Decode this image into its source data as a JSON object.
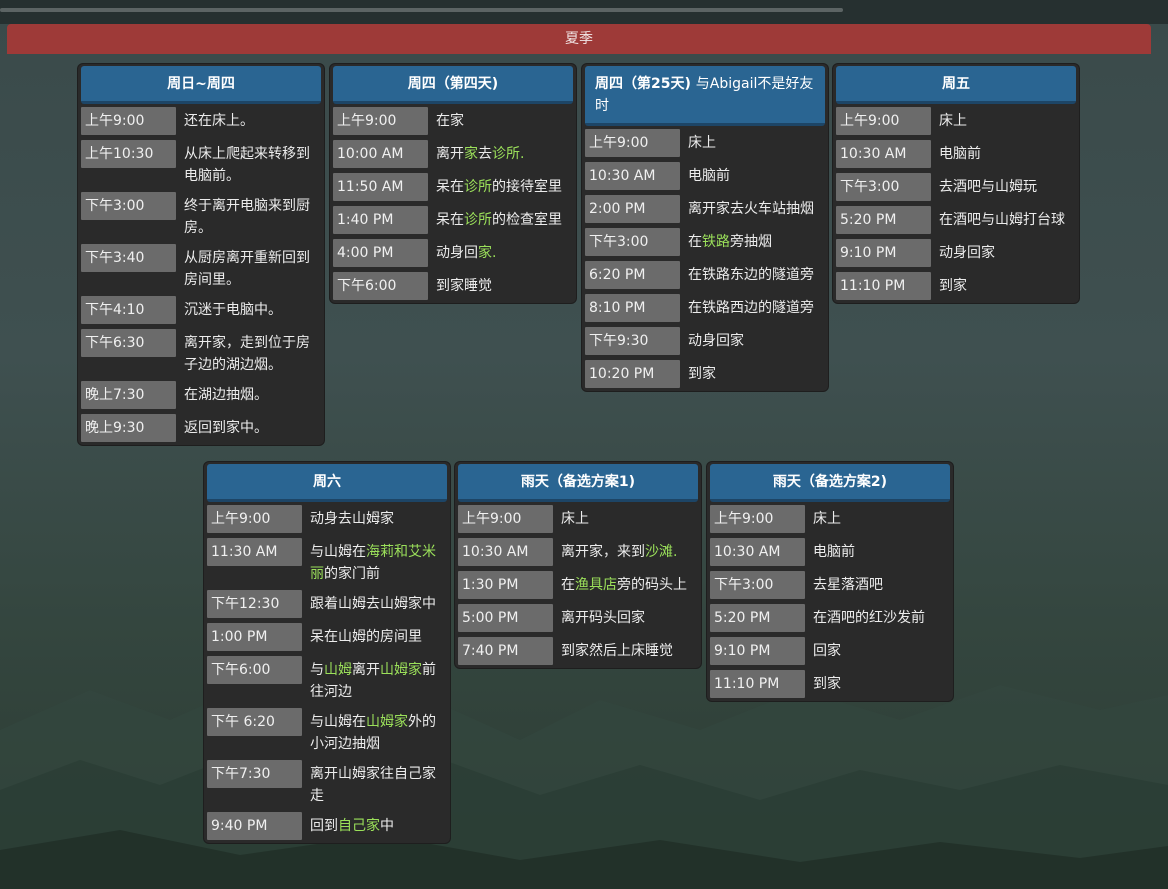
{
  "header": {
    "season": "夏季"
  },
  "cards": [
    {
      "title": "周日~周四",
      "rows": [
        {
          "time": "上午9:00",
          "desc": [
            {
              "t": "还在床上。"
            }
          ]
        },
        {
          "time": "上午10:30",
          "desc": [
            {
              "t": "从床上爬起来转移到电脑前。"
            }
          ]
        },
        {
          "time": "下午3:00",
          "desc": [
            {
              "t": "终于离开电脑来到厨房。"
            }
          ]
        },
        {
          "time": "下午3:40",
          "desc": [
            {
              "t": "从厨房离开重新回到房间里。"
            }
          ]
        },
        {
          "time": "下午4:10",
          "desc": [
            {
              "t": "沉迷于电脑中。"
            }
          ]
        },
        {
          "time": "下午6:30",
          "desc": [
            {
              "t": "离开家，走到位于房子边的湖边烟。"
            }
          ]
        },
        {
          "time": "晚上7:30",
          "desc": [
            {
              "t": "在湖边抽烟。"
            }
          ]
        },
        {
          "time": "晚上9:30",
          "desc": [
            {
              "t": "返回到家中。"
            }
          ]
        }
      ]
    },
    {
      "title": "周四（第四天)",
      "rows": [
        {
          "time": "上午9:00",
          "desc": [
            {
              "t": "在家"
            }
          ]
        },
        {
          "time": "10:00 AM",
          "desc": [
            {
              "t": "离开"
            },
            {
              "t": "家",
              "hl": true
            },
            {
              "t": "去"
            },
            {
              "t": "诊所.",
              "hl": true
            }
          ]
        },
        {
          "time": "11:50 AM",
          "desc": [
            {
              "t": "呆在"
            },
            {
              "t": "诊所",
              "hl": true
            },
            {
              "t": "的接待室里"
            }
          ]
        },
        {
          "time": "1:40 PM",
          "desc": [
            {
              "t": "呆在"
            },
            {
              "t": "诊所",
              "hl": true
            },
            {
              "t": "的检查室里"
            }
          ]
        },
        {
          "time": "4:00 PM",
          "desc": [
            {
              "t": "动身回"
            },
            {
              "t": "家.",
              "hl": true
            }
          ]
        },
        {
          "time": "下午6:00",
          "desc": [
            {
              "t": "到家睡觉"
            }
          ]
        }
      ]
    },
    {
      "title": "周四（第25天)",
      "title_extra": "与Abigail不是好友时",
      "rows": [
        {
          "time": "上午9:00",
          "desc": [
            {
              "t": "床上"
            }
          ]
        },
        {
          "time": "10:30 AM",
          "desc": [
            {
              "t": "电脑前"
            }
          ]
        },
        {
          "time": "2:00 PM",
          "desc": [
            {
              "t": "离开家去火车站抽烟"
            }
          ]
        },
        {
          "time": "下午3:00",
          "desc": [
            {
              "t": "在"
            },
            {
              "t": "铁路",
              "hl": true
            },
            {
              "t": "旁抽烟"
            }
          ]
        },
        {
          "time": "6:20 PM",
          "desc": [
            {
              "t": "在铁路东边的隧道旁"
            }
          ]
        },
        {
          "time": "8:10 PM",
          "desc": [
            {
              "t": "在铁路西边的隧道旁"
            }
          ]
        },
        {
          "time": "下午9:30",
          "desc": [
            {
              "t": "动身回家"
            }
          ]
        },
        {
          "time": "10:20 PM",
          "desc": [
            {
              "t": "到家"
            }
          ]
        }
      ]
    },
    {
      "title": "周五",
      "rows": [
        {
          "time": "上午9:00",
          "desc": [
            {
              "t": "床上"
            }
          ]
        },
        {
          "time": "10:30 AM",
          "desc": [
            {
              "t": "电脑前"
            }
          ]
        },
        {
          "time": "下午3:00",
          "desc": [
            {
              "t": "去酒吧与山姆玩"
            }
          ]
        },
        {
          "time": "5:20 PM",
          "desc": [
            {
              "t": "在酒吧与山姆打台球"
            }
          ]
        },
        {
          "time": "9:10 PM",
          "desc": [
            {
              "t": "动身回家"
            }
          ]
        },
        {
          "time": "11:10 PM",
          "desc": [
            {
              "t": "到家"
            }
          ]
        }
      ]
    },
    {
      "title": "周六",
      "rows": [
        {
          "time": "上午9:00",
          "desc": [
            {
              "t": "动身去山姆家"
            }
          ]
        },
        {
          "time": "11:30 AM",
          "desc": [
            {
              "t": "与山姆在"
            },
            {
              "t": "海莉和艾米丽",
              "hl": true
            },
            {
              "t": "的家门前"
            }
          ]
        },
        {
          "time": "下午12:30",
          "desc": [
            {
              "t": "跟着山姆去山姆家中"
            }
          ]
        },
        {
          "time": "1:00 PM",
          "desc": [
            {
              "t": "呆在山姆的房间里"
            }
          ]
        },
        {
          "time": "下午6:00",
          "desc": [
            {
              "t": "与"
            },
            {
              "t": "山姆",
              "hl": true
            },
            {
              "t": "离开"
            },
            {
              "t": "山姆家",
              "hl": true
            },
            {
              "t": "前往河边"
            }
          ]
        },
        {
          "time": "下午 6:20",
          "desc": [
            {
              "t": "与山姆在"
            },
            {
              "t": "山姆家",
              "hl": true
            },
            {
              "t": "外的小河边抽烟"
            }
          ]
        },
        {
          "time": "下午7:30",
          "desc": [
            {
              "t": "离开山姆家往自己家走"
            }
          ]
        },
        {
          "time": "9:40 PM",
          "desc": [
            {
              "t": "回到"
            },
            {
              "t": "自己家",
              "hl": true
            },
            {
              "t": "中"
            }
          ]
        }
      ]
    },
    {
      "title": "雨天（备选方案1)",
      "rows": [
        {
          "time": "上午9:00",
          "desc": [
            {
              "t": "床上"
            }
          ]
        },
        {
          "time": "10:30 AM",
          "desc": [
            {
              "t": "离开家，来到"
            },
            {
              "t": "沙滩.",
              "hl": true
            }
          ]
        },
        {
          "time": "1:30 PM",
          "desc": [
            {
              "t": "在"
            },
            {
              "t": "渔具店",
              "hl": true
            },
            {
              "t": "旁的码头上"
            }
          ]
        },
        {
          "time": "5:00 PM",
          "desc": [
            {
              "t": "离开码头回家"
            }
          ]
        },
        {
          "time": "7:40 PM",
          "desc": [
            {
              "t": "到家然后上床睡觉"
            }
          ]
        }
      ]
    },
    {
      "title": "雨天（备选方案2)",
      "rows": [
        {
          "time": "上午9:00",
          "desc": [
            {
              "t": "床上"
            }
          ]
        },
        {
          "time": "10:30 AM",
          "desc": [
            {
              "t": "电脑前"
            }
          ]
        },
        {
          "time": "下午3:00",
          "desc": [
            {
              "t": "去星落酒吧"
            }
          ]
        },
        {
          "time": "5:20 PM",
          "desc": [
            {
              "t": "在酒吧的红沙发前"
            }
          ]
        },
        {
          "time": "9:10 PM",
          "desc": [
            {
              "t": "回家"
            }
          ]
        },
        {
          "time": "11:10 PM",
          "desc": [
            {
              "t": "到家"
            }
          ]
        }
      ]
    }
  ]
}
